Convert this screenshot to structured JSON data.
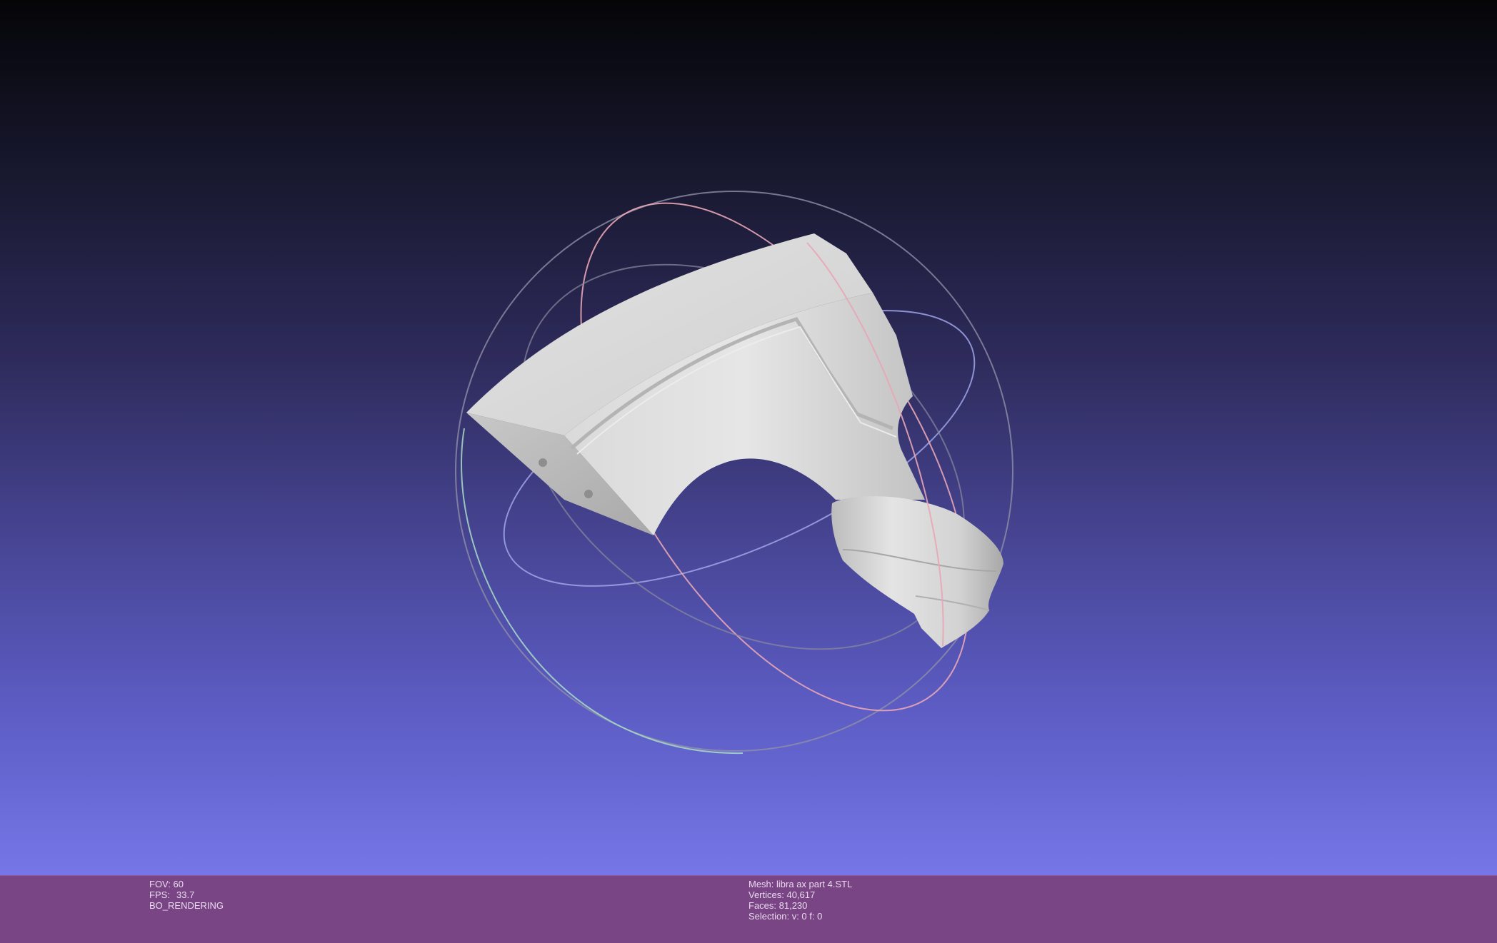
{
  "viewport": {
    "background_top": "#050508",
    "background_bottom": "#7676e8"
  },
  "trackball": {
    "colors": {
      "ring_x": "#e8a6b6",
      "ring_y": "#9aa6e8",
      "ring_z": "#a8dcc8",
      "ring_gray": "#8a8aa0"
    }
  },
  "mesh": {
    "color": "#d8d8d8"
  },
  "status_left": {
    "fov": "FOV: 60",
    "fps_label": "FPS:",
    "fps_value": "33.7",
    "mode": "BO_RENDERING"
  },
  "status_right": {
    "mesh": "Mesh: libra ax part 4.STL",
    "vertices": "Vertices: 40,617",
    "faces": "Faces: 81,230",
    "selection": "Selection: v: 0 f: 0"
  },
  "info_bar": {
    "color": "#7a4585"
  }
}
